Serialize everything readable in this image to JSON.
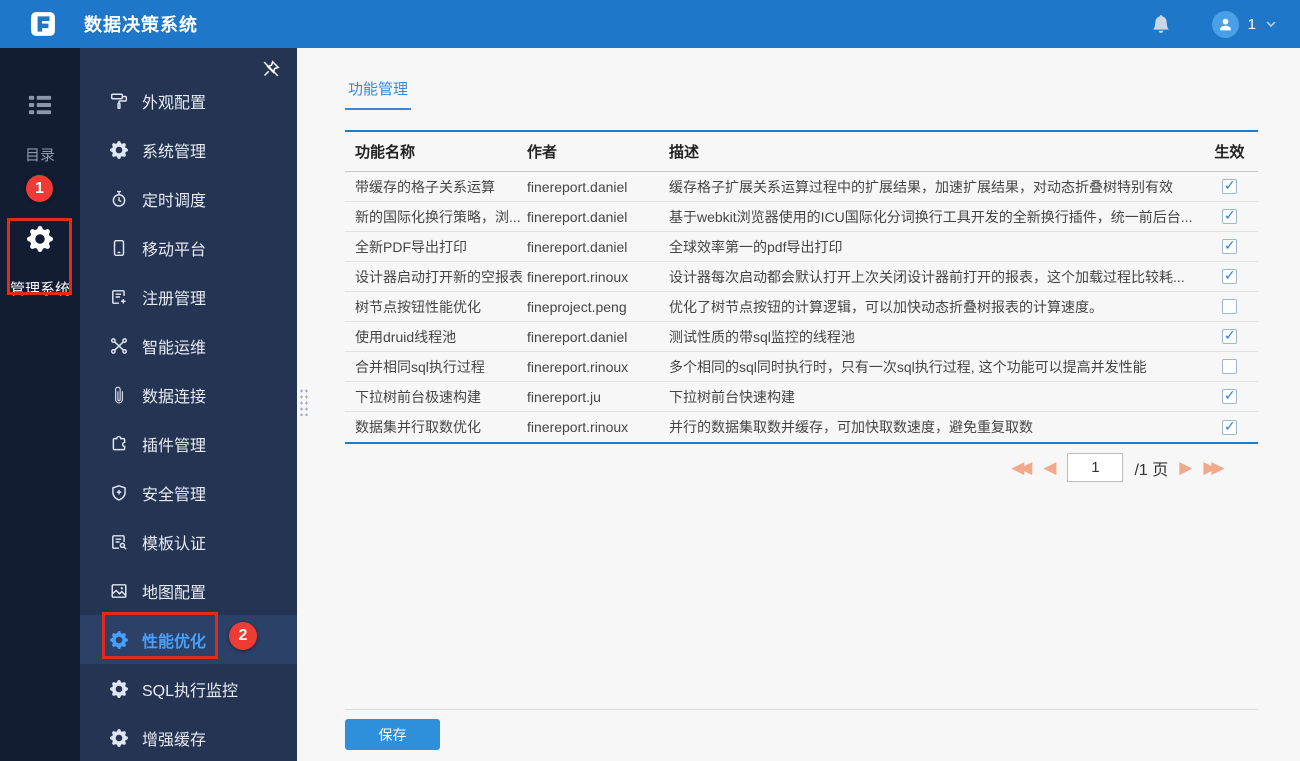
{
  "header": {
    "title": "数据决策系统",
    "user": {
      "name": "1"
    }
  },
  "rail": {
    "items": [
      {
        "label": "目录",
        "icon": "directory-icon",
        "active": false
      },
      {
        "label": "管理系统",
        "icon": "gear-icon",
        "active": true
      }
    ]
  },
  "annotations": {
    "step1": "1",
    "step2": "2"
  },
  "sidebar": {
    "items": [
      {
        "label": "外观配置",
        "icon": "paint-roller-icon",
        "active": false
      },
      {
        "label": "系统管理",
        "icon": "gear-icon",
        "active": false
      },
      {
        "label": "定时调度",
        "icon": "timer-icon",
        "active": false
      },
      {
        "label": "移动平台",
        "icon": "mobile-icon",
        "active": false
      },
      {
        "label": "注册管理",
        "icon": "register-icon",
        "active": false
      },
      {
        "label": "智能运维",
        "icon": "ops-icon",
        "active": false
      },
      {
        "label": "数据连接",
        "icon": "link-icon",
        "active": false
      },
      {
        "label": "插件管理",
        "icon": "plugin-icon",
        "active": false
      },
      {
        "label": "安全管理",
        "icon": "shield-icon",
        "active": false
      },
      {
        "label": "模板认证",
        "icon": "certificate-icon",
        "active": false
      },
      {
        "label": "地图配置",
        "icon": "map-icon",
        "active": false
      },
      {
        "label": "性能优化",
        "icon": "gear-icon",
        "active": true
      },
      {
        "label": "SQL执行监控",
        "icon": "gear-icon",
        "active": false
      },
      {
        "label": "增强缓存",
        "icon": "gear-icon",
        "active": false
      }
    ]
  },
  "main": {
    "tab": "功能管理",
    "table": {
      "columns": [
        "功能名称",
        "作者",
        "描述",
        "生效"
      ],
      "rows": [
        {
          "name": "带缓存的格子关系运算",
          "author": "finereport.daniel",
          "desc": "缓存格子扩展关系运算过程中的扩展结果，加速扩展结果，对动态折叠树特别有效",
          "enabled": true
        },
        {
          "name": "新的国际化换行策略，浏...",
          "author": "finereport.daniel",
          "desc": "基于webkit浏览器使用的ICU国际化分词换行工具开发的全新换行插件，统一前后台...",
          "enabled": true
        },
        {
          "name": "全新PDF导出打印",
          "author": "finereport.daniel",
          "desc": "全球效率第一的pdf导出打印",
          "enabled": true
        },
        {
          "name": "设计器启动打开新的空报表",
          "author": "finereport.rinoux",
          "desc": "设计器每次启动都会默认打开上次关闭设计器前打开的报表，这个加载过程比较耗...",
          "enabled": true
        },
        {
          "name": "树节点按钮性能优化",
          "author": "fineproject.peng",
          "desc": "优化了树节点按钮的计算逻辑，可以加快动态折叠树报表的计算速度。",
          "enabled": false
        },
        {
          "name": "使用druid线程池",
          "author": "finereport.daniel",
          "desc": "测试性质的带sql监控的线程池",
          "enabled": true
        },
        {
          "name": "合并相同sql执行过程",
          "author": "finereport.rinoux",
          "desc": "多个相同的sql同时执行时，只有一次sql执行过程, 这个功能可以提高并发性能",
          "enabled": false
        },
        {
          "name": "下拉树前台极速构建",
          "author": "finereport.ju",
          "desc": "下拉树前台快速构建",
          "enabled": true
        },
        {
          "name": "数据集并行取数优化",
          "author": "finereport.rinoux",
          "desc": "并行的数据集取数并缓存，可加快取数速度，避免重复取数",
          "enabled": true
        }
      ]
    },
    "pagination": {
      "current": "1",
      "total_label": "/1 页"
    },
    "save_label": "保存"
  },
  "colors": {
    "header_blue": "#1e77c8",
    "accent_blue": "#3a87d9",
    "table_border_blue": "#2878c8",
    "annotation_red": "#e02b20",
    "pagination_arrow": "#f2a98b",
    "sidebar_dark": "#121d33",
    "submenu_dark": "#253452"
  }
}
